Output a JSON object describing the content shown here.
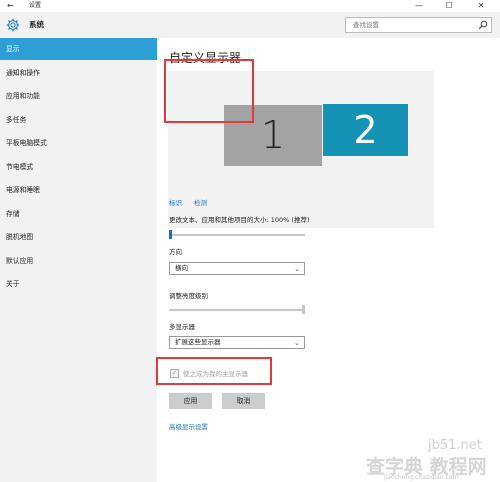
{
  "titlebar": {
    "back_icon": "←",
    "title": "设置",
    "minimize": "—",
    "maximize": "☐",
    "close": "✕"
  },
  "header": {
    "icon": "gear-icon",
    "title": "系统",
    "search_placeholder": "查找设置",
    "search_icon": "search-icon"
  },
  "sidebar": {
    "items": [
      {
        "label": "显示",
        "active": true
      },
      {
        "label": "通知和操作"
      },
      {
        "label": "应用和功能"
      },
      {
        "label": "多任务"
      },
      {
        "label": "平板电脑模式"
      },
      {
        "label": "节电模式"
      },
      {
        "label": "电源和睡眠"
      },
      {
        "label": "存储"
      },
      {
        "label": "脱机地图"
      },
      {
        "label": "默认应用"
      },
      {
        "label": "关于"
      }
    ]
  },
  "main": {
    "title": "自定义显示器",
    "monitors": [
      {
        "label": "1",
        "color": "#a3a3a3"
      },
      {
        "label": "2",
        "color": "#1493b5",
        "selected": true
      }
    ],
    "identify_link": "标识",
    "detect_link": "检测",
    "scale_label": "更改文本、应用和其他项目的大小: 100% (推荐)",
    "scale_value_percent": 0,
    "orientation_label": "方向",
    "orientation_value": "横向",
    "brightness_label": "调整亮度级别",
    "brightness_value_percent": 100,
    "multi_display_label": "多显示器",
    "multi_display_value": "扩展这些显示器",
    "make_main_label": "使之成为我的主显示器",
    "make_main_checked": true,
    "apply_button": "应用",
    "cancel_button": "取消",
    "advanced_link": "高级显示设置"
  },
  "watermark": {
    "line1": "jb51.net",
    "line2": "查字典 教程网",
    "line3": "jiaocheng.chazidian.com"
  },
  "colors": {
    "accent": "#2e9fd6",
    "link": "#1a70c2",
    "highlight": "#e03a3a",
    "sidebar_bg": "#f2f2f2"
  }
}
